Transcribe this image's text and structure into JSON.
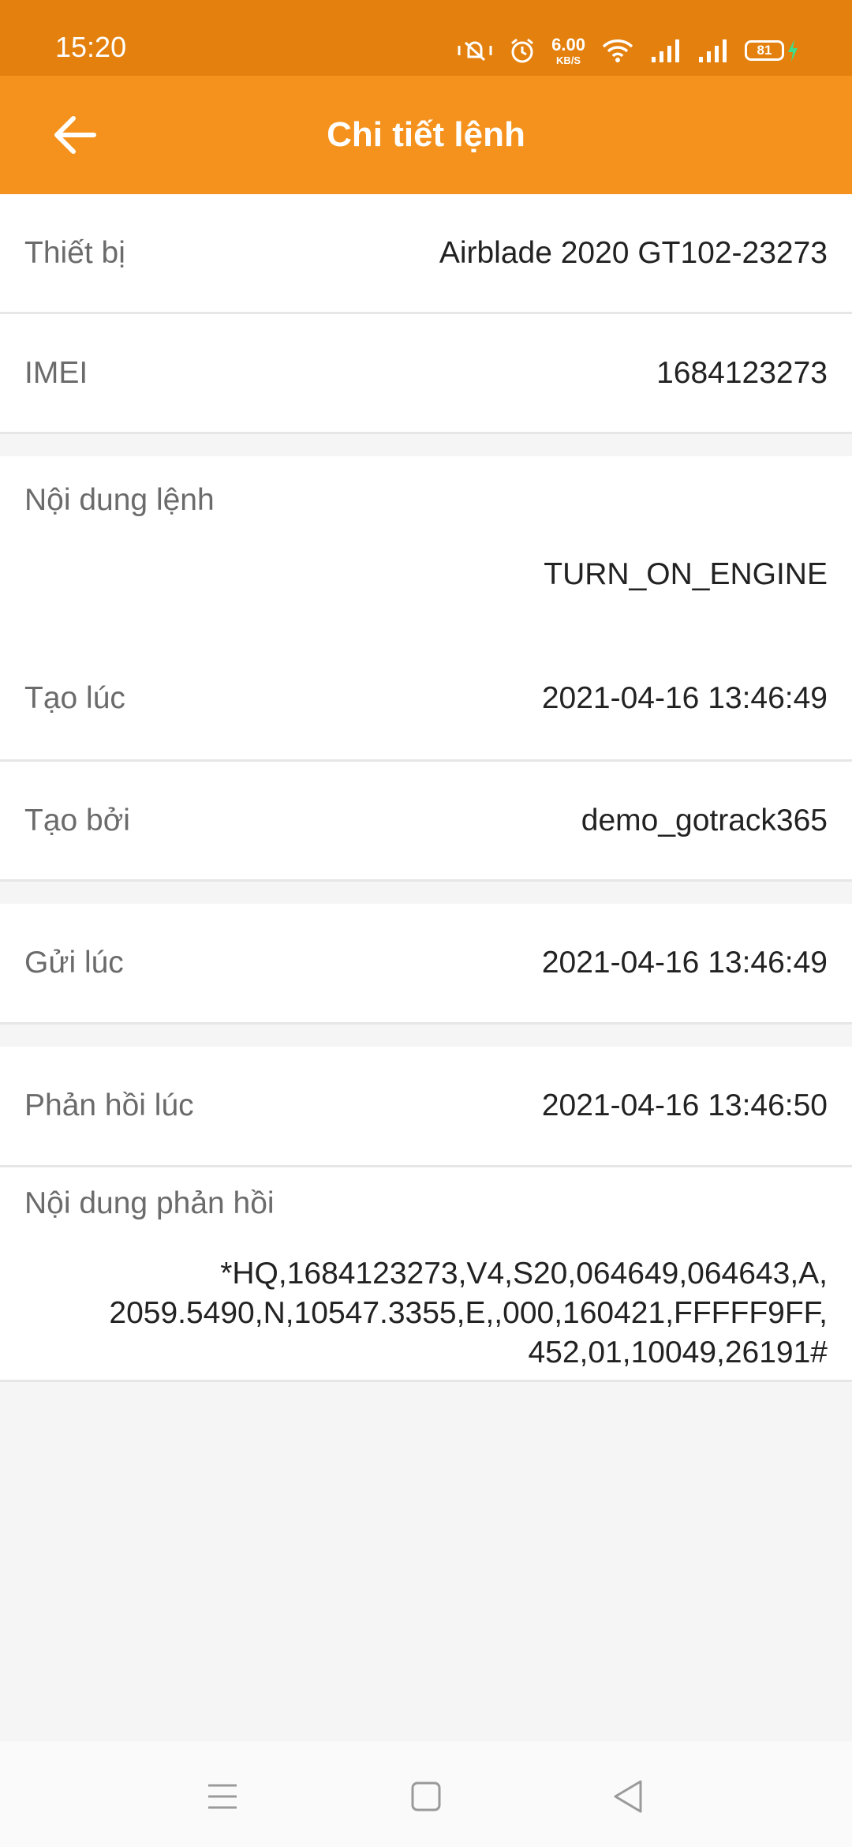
{
  "status_bar": {
    "time": "15:20",
    "net_speed_value": "6.00",
    "net_speed_unit": "KB/S",
    "battery_level": "81",
    "icons": [
      "mute-vibrate-icon",
      "alarm-icon",
      "wifi-icon",
      "signal-icon",
      "signal-icon",
      "battery-icon",
      "charging-icon"
    ]
  },
  "app_bar": {
    "title": "Chi tiết lệnh",
    "back_icon": "arrow-left-icon",
    "color": "#f5921d"
  },
  "details": {
    "device": {
      "label": "Thiết bị",
      "value": "Airblade 2020 GT102-23273"
    },
    "imei": {
      "label": "IMEI",
      "value": "1684123273"
    },
    "command": {
      "label": "Nội dung lệnh",
      "value": "TURN_ON_ENGINE"
    },
    "created_at": {
      "label": "Tạo lúc",
      "value": "2021-04-16 13:46:49"
    },
    "created_by": {
      "label": "Tạo bởi",
      "value": "demo_gotrack365"
    },
    "sent_at": {
      "label": "Gửi lúc",
      "value": "2021-04-16 13:46:49"
    },
    "responded_at": {
      "label": "Phản hồi lúc",
      "value": "2021-04-16 13:46:50"
    },
    "response": {
      "label": "Nội dung phản hồi",
      "lines": [
        "*HQ,1684123273,V4,S20,064649,064643,A,",
        "2059.5490,N,10547.3355,E,,000,160421,FFFFF9FF,",
        "452,01,10049,26191#"
      ]
    }
  },
  "nav_bar": {
    "icons": [
      "menu-icon",
      "home-square-icon",
      "back-triangle-icon"
    ]
  }
}
